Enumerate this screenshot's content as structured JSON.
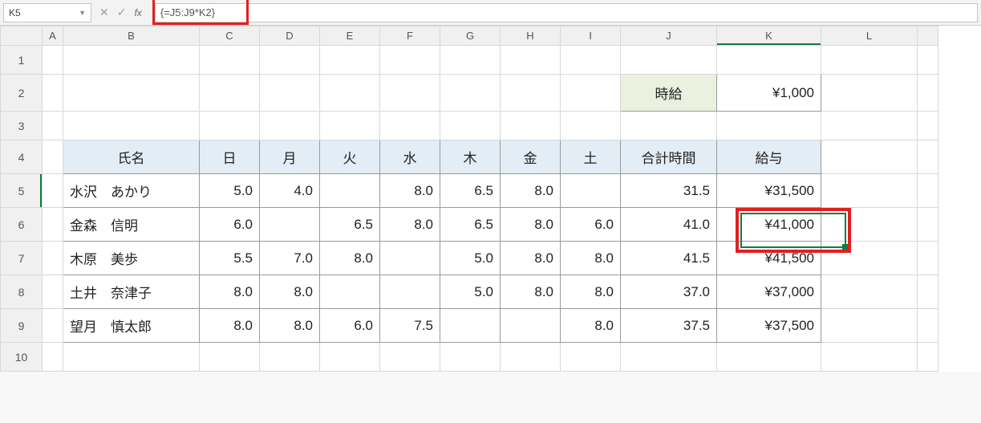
{
  "formula_bar": {
    "cell_ref": "K5",
    "formula": "{=J5:J9*K2}"
  },
  "columns": [
    "A",
    "B",
    "C",
    "D",
    "E",
    "F",
    "G",
    "H",
    "I",
    "J",
    "K",
    "L"
  ],
  "row_labels": [
    "1",
    "2",
    "3",
    "4",
    "5",
    "6",
    "7",
    "8",
    "9",
    "10"
  ],
  "row2": {
    "label": "時給",
    "value": "¥1,000"
  },
  "headers": {
    "name": "氏名",
    "sun": "日",
    "mon": "月",
    "tue": "火",
    "wed": "水",
    "thu": "木",
    "fri": "金",
    "sat": "土",
    "total": "合計時間",
    "pay": "給与"
  },
  "rows": [
    {
      "name": "水沢　あかり",
      "d": [
        "5.0",
        "4.0",
        "",
        "8.0",
        "6.5",
        "8.0",
        ""
      ],
      "total": "31.5",
      "pay": "¥31,500"
    },
    {
      "name": "金森　信明",
      "d": [
        "6.0",
        "",
        "6.5",
        "8.0",
        "6.5",
        "8.0",
        "6.0"
      ],
      "total": "41.0",
      "pay": "¥41,000"
    },
    {
      "name": "木原　美歩",
      "d": [
        "5.5",
        "7.0",
        "8.0",
        "",
        "5.0",
        "8.0",
        "8.0"
      ],
      "total": "41.5",
      "pay": "¥41,500"
    },
    {
      "name": "土井　奈津子",
      "d": [
        "8.0",
        "8.0",
        "",
        "",
        "5.0",
        "8.0",
        "8.0"
      ],
      "total": "37.0",
      "pay": "¥37,000"
    },
    {
      "name": "望月　慎太郎",
      "d": [
        "8.0",
        "8.0",
        "6.0",
        "7.5",
        "",
        "",
        "8.0"
      ],
      "total": "37.5",
      "pay": "¥37,500"
    }
  ],
  "chart_data": {
    "type": "table",
    "title": "",
    "hourly_wage_yen": 1000,
    "columns": [
      "氏名",
      "日",
      "月",
      "火",
      "水",
      "木",
      "金",
      "土",
      "合計時間",
      "給与"
    ],
    "records": [
      {
        "氏名": "水沢　あかり",
        "日": 5.0,
        "月": 4.0,
        "火": null,
        "水": 8.0,
        "木": 6.5,
        "金": 8.0,
        "土": null,
        "合計時間": 31.5,
        "給与": 31500
      },
      {
        "氏名": "金森　信明",
        "日": 6.0,
        "月": null,
        "火": 6.5,
        "水": 8.0,
        "木": 6.5,
        "金": 8.0,
        "土": 6.0,
        "合計時間": 41.0,
        "給与": 41000
      },
      {
        "氏名": "木原　美歩",
        "日": 5.5,
        "月": 7.0,
        "火": 8.0,
        "水": null,
        "木": 5.0,
        "金": 8.0,
        "土": 8.0,
        "合計時間": 41.5,
        "給与": 41500
      },
      {
        "氏名": "土井　奈津子",
        "日": 8.0,
        "月": 8.0,
        "火": null,
        "水": null,
        "木": 5.0,
        "金": 8.0,
        "土": 8.0,
        "合計時間": 37.0,
        "給与": 37000
      },
      {
        "氏名": "望月　慎太郎",
        "日": 8.0,
        "月": 8.0,
        "火": 6.0,
        "水": 7.5,
        "木": null,
        "金": null,
        "土": 8.0,
        "合計時間": 37.5,
        "給与": 37500
      }
    ]
  }
}
